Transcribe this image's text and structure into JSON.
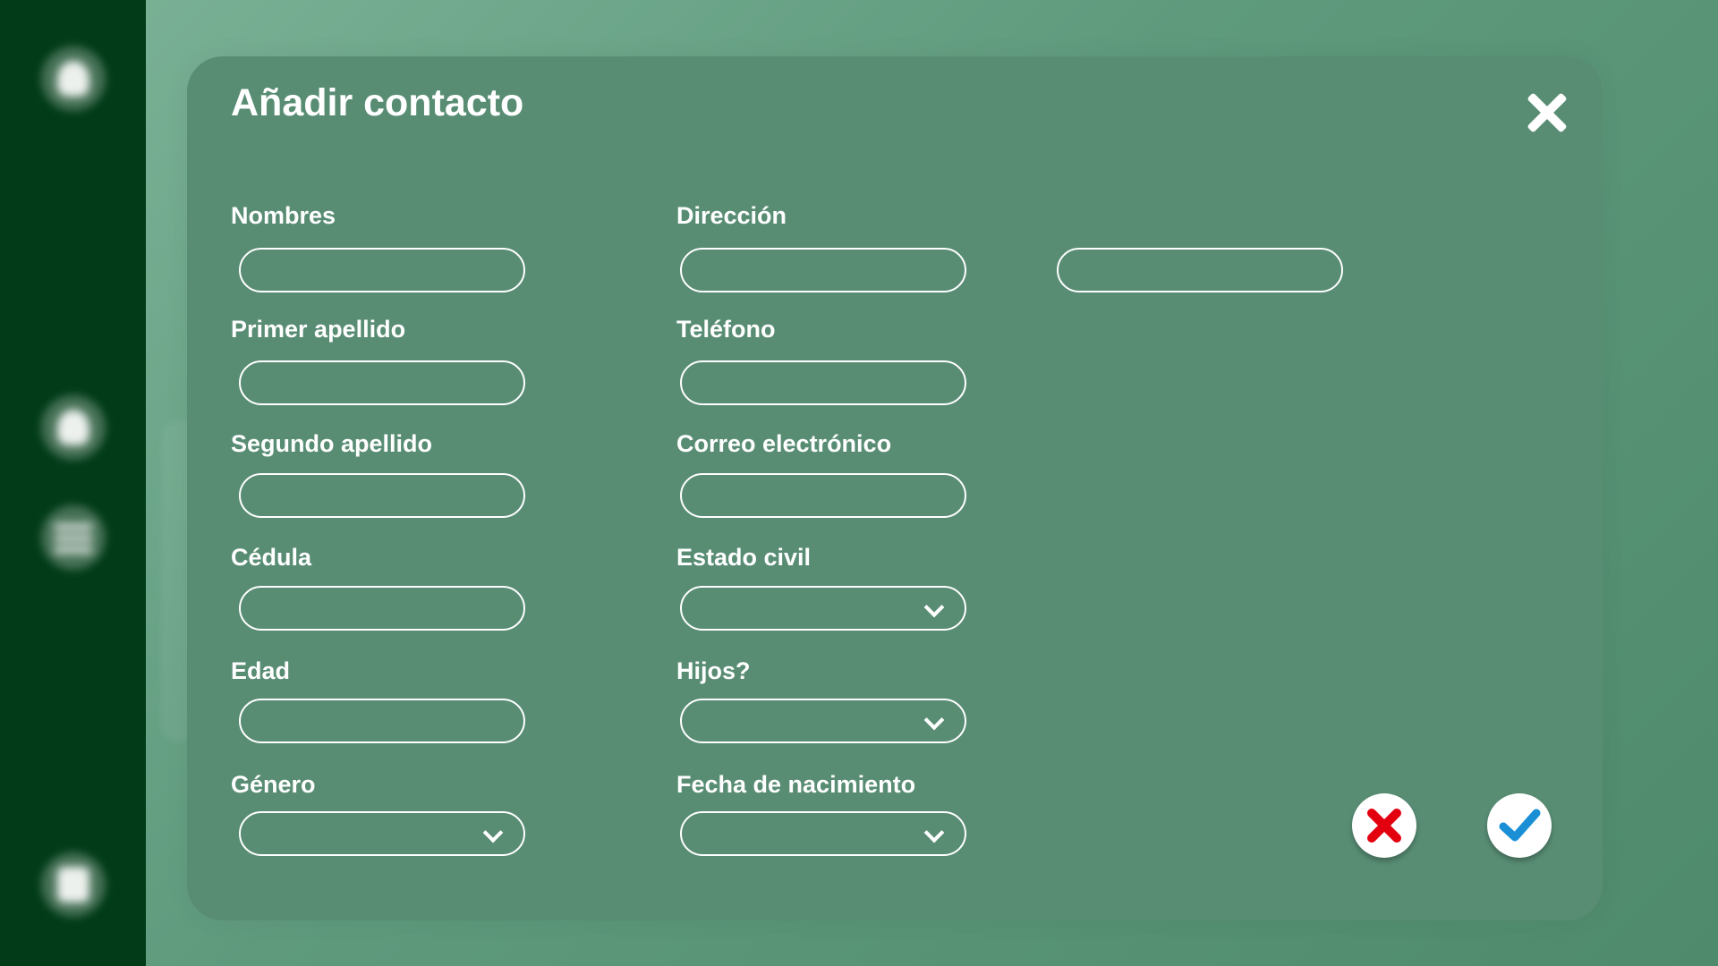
{
  "sidebar": {
    "items": [
      {
        "name": "profile",
        "icon": "user-icon"
      },
      {
        "name": "add-contact",
        "icon": "add-user-icon"
      },
      {
        "name": "contact-list",
        "icon": "list-icon"
      },
      {
        "name": "logout",
        "icon": "logout-icon"
      }
    ]
  },
  "dialog": {
    "title": "Añadir contacto",
    "close_icon": "close-icon",
    "fields": {
      "nombres": {
        "label": "Nombres",
        "value": ""
      },
      "primer_apellido": {
        "label": "Primer apellido",
        "value": ""
      },
      "segundo_apellido": {
        "label": "Segundo apellido",
        "value": ""
      },
      "cedula": {
        "label": "Cédula",
        "value": ""
      },
      "edad": {
        "label": "Edad",
        "value": ""
      },
      "genero": {
        "label": "Género",
        "value": ""
      },
      "direccion": {
        "label": "Dirección",
        "value": "",
        "value2": ""
      },
      "telefono": {
        "label": "Teléfono",
        "value": ""
      },
      "correo": {
        "label": "Correo electrónico",
        "value": ""
      },
      "estado_civil": {
        "label": "Estado civil",
        "value": ""
      },
      "hijos": {
        "label": "Hijos?",
        "value": ""
      },
      "fecha_nacimiento": {
        "label": "Fecha de nacimiento",
        "value": ""
      }
    },
    "actions": {
      "cancel_icon": "cancel-x-icon",
      "confirm_icon": "checkmark-icon"
    }
  },
  "colors": {
    "sidebar": "#013b17",
    "dialog": "#588d74",
    "cancel": "#e3000f",
    "confirm": "#1a8fd6"
  }
}
